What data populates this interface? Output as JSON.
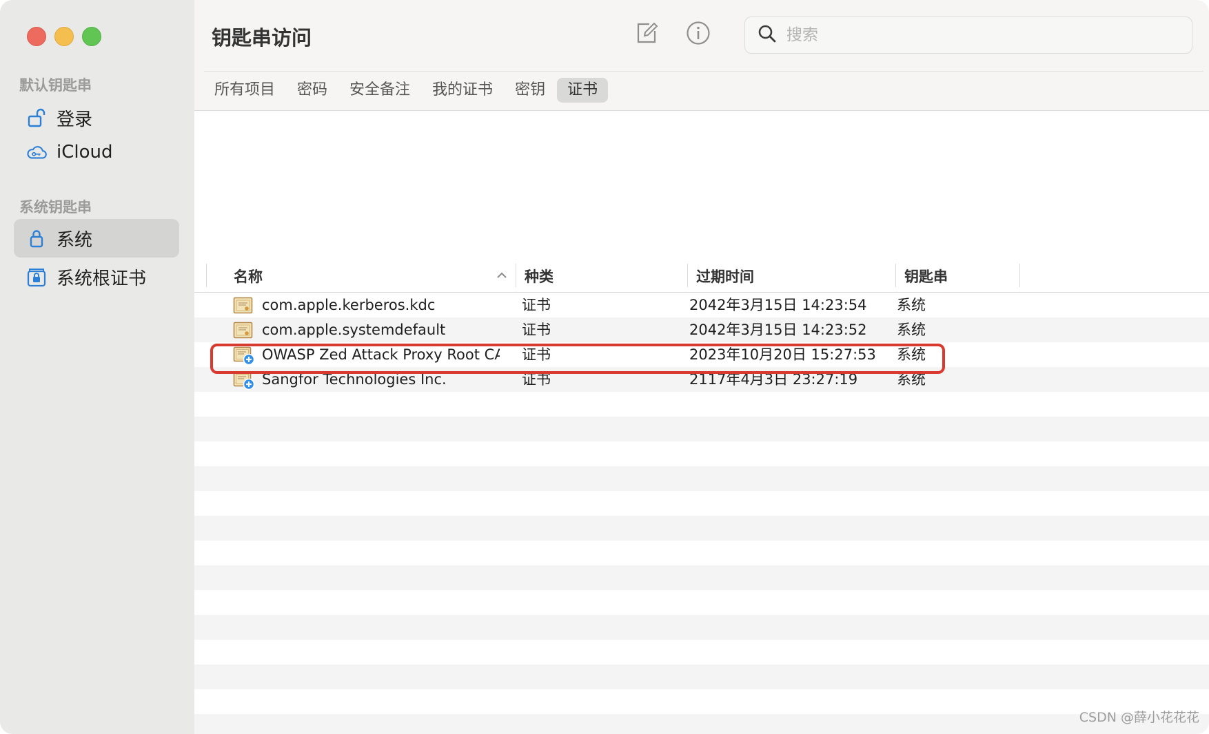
{
  "window": {
    "title": "钥匙串访问"
  },
  "sidebar": {
    "default_section": "默认钥匙串",
    "system_section": "系统钥匙串",
    "items": [
      {
        "label": "登录",
        "icon": "unlock-icon",
        "selected": false
      },
      {
        "label": "iCloud",
        "icon": "icloud-icon",
        "selected": false
      },
      {
        "label": "系统",
        "icon": "lock-icon",
        "selected": true
      },
      {
        "label": "系统根证书",
        "icon": "lock-cabinet-icon",
        "selected": false
      }
    ]
  },
  "toolbar": {
    "compose_icon": "compose-icon",
    "info_icon": "info-icon",
    "search_placeholder": "搜索"
  },
  "tabs": [
    {
      "label": "所有项目",
      "active": false
    },
    {
      "label": "密码",
      "active": false
    },
    {
      "label": "安全备注",
      "active": false
    },
    {
      "label": "我的证书",
      "active": false
    },
    {
      "label": "密钥",
      "active": false
    },
    {
      "label": "证书",
      "active": true
    }
  ],
  "table": {
    "columns": {
      "name": "名称",
      "kind": "种类",
      "expires": "过期时间",
      "keychain": "钥匙串"
    },
    "rows": [
      {
        "name": "com.apple.kerberos.kdc",
        "kind": "证书",
        "expires": "2042年3月15日 14:23:54",
        "keychain": "系统",
        "icon": "certificate-icon"
      },
      {
        "name": "com.apple.systemdefault",
        "kind": "证书",
        "expires": "2042年3月15日 14:23:52",
        "keychain": "系统",
        "icon": "certificate-icon"
      },
      {
        "name": "OWASP Zed Attack Proxy Root CA",
        "kind": "证书",
        "expires": "2023年10月20日 15:27:53",
        "keychain": "系统",
        "icon": "certificate-trusted-icon"
      },
      {
        "name": "Sangfor Technologies Inc.",
        "kind": "证书",
        "expires": "2117年4月3日 23:27:19",
        "keychain": "系统",
        "icon": "certificate-trusted-icon"
      }
    ]
  },
  "watermark": "CSDN @薛小花花花",
  "colors": {
    "highlight": "#d93a2f",
    "accent": "#2b7fd6"
  }
}
